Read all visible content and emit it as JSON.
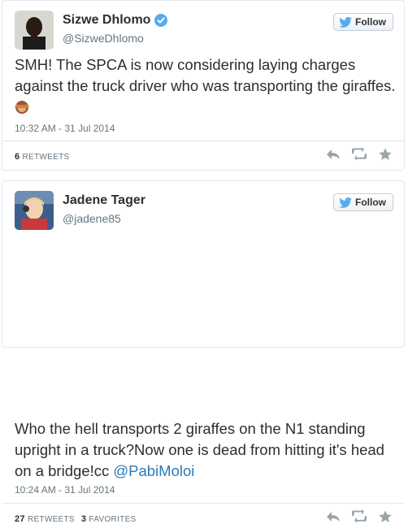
{
  "tweets": [
    {
      "name": "Sizwe Dhlomo",
      "handle": "@SizweDhlomo",
      "verified": true,
      "follow_label": "Follow",
      "text": "SMH! The SPCA is now considering laying charges against the truck driver who was transporting the giraffes.",
      "emoji": "see-no-evil-monkey-icon",
      "timestamp": "10:32 AM - 31 Jul 2014",
      "retweets_count": "6",
      "retweets_label": "RETWEETS"
    },
    {
      "name": "Jadene Tager",
      "handle": "@jadene85",
      "verified": false,
      "follow_label": "Follow",
      "text": "Who the hell transports 2 giraffes on the N1 standing upright in a truck?Now one is dead from hitting it's head on a bridge!cc",
      "mention": "@PabiMoloi",
      "timestamp": "10:24 AM - 31 Jul 2014",
      "retweets_count": "27",
      "retweets_label": "RETWEETS",
      "favorites_count": "3",
      "favorites_label": "FAVORITES"
    }
  ],
  "colors": {
    "accent": "#2b7bb9",
    "twitter_blue": "#55acee",
    "muted": "#66757f",
    "border": "#e1e8ed"
  }
}
